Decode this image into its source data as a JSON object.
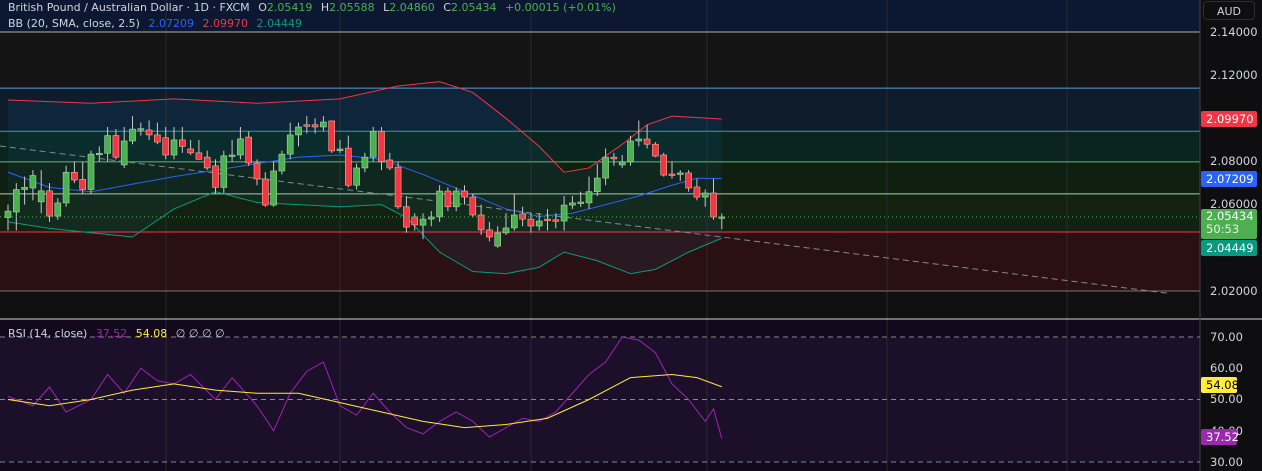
{
  "header": {
    "symbol": "British Pound / Australian Dollar · 1D · FXCM",
    "open_label": "O",
    "open": "2.05419",
    "high_label": "H",
    "high": "2.05588",
    "low_label": "L",
    "low": "2.04860",
    "close_label": "C",
    "close": "2.05434",
    "change": "+0.00015 (+0.01%)"
  },
  "bb_legend": {
    "label": "BB (20, SMA, close, 2.5)",
    "basis": "2.07209",
    "upper": "2.09970",
    "lower": "2.04449"
  },
  "rsi_legend": {
    "label": "RSI (14, close)",
    "rsi": "37.52",
    "ma": "54.08",
    "extras": "∅ ∅ ∅ ∅"
  },
  "price_axis": {
    "currency": "AUD",
    "ticks": [
      "2.14000",
      "2.12000",
      "2.08000",
      "2.06000",
      "2.02000"
    ],
    "upper_tag": "2.09970",
    "basis_tag": "2.07209",
    "last_price": "2.05434",
    "countdown": "50:53",
    "lower_tag": "2.04449"
  },
  "rsi_axis": {
    "ticks": [
      "70.00",
      "60.00",
      "50.00",
      "40.00",
      "30.00"
    ],
    "ma_tag": "54.08",
    "rsi_tag": "37.52"
  },
  "colors": {
    "up": "#4caf50",
    "down": "#f23645",
    "basis": "#2962ff",
    "upper": "#f23645",
    "lower": "#089981",
    "rsi": "#9c27b0",
    "rsi_ma": "#ffeb3b"
  },
  "chart_data": [
    {
      "type": "candlestick",
      "title": "British Pound / Australian Dollar · 1D · FXCM",
      "ylim": [
        2.0,
        2.15
      ],
      "grid": true,
      "candles": [
        [
          2.054,
          2.06,
          2.048,
          2.057
        ],
        [
          2.0566,
          2.07,
          2.048,
          2.067
        ],
        [
          2.067,
          2.073,
          2.06,
          2.068
        ],
        [
          2.0677,
          2.076,
          2.062,
          2.0735
        ],
        [
          2.0613,
          2.076,
          2.056,
          2.0664
        ],
        [
          2.0664,
          2.07,
          2.052,
          2.0547
        ],
        [
          2.0547,
          2.063,
          2.053,
          2.0608
        ],
        [
          2.0608,
          2.078,
          2.059,
          2.075
        ],
        [
          2.075,
          2.08,
          2.07,
          2.0714
        ],
        [
          2.0717,
          2.08,
          2.065,
          2.067
        ],
        [
          2.067,
          2.085,
          2.065,
          2.0834
        ],
        [
          2.0834,
          2.087,
          2.08,
          2.0838
        ],
        [
          2.0838,
          2.096,
          2.08,
          2.092
        ],
        [
          2.092,
          2.095,
          2.081,
          2.082
        ],
        [
          2.0784,
          2.096,
          2.077,
          2.0895
        ],
        [
          2.0895,
          2.101,
          2.088,
          2.095
        ],
        [
          2.095,
          2.098,
          2.092,
          2.0952
        ],
        [
          2.0946,
          2.099,
          2.09,
          2.0923
        ],
        [
          2.0923,
          2.098,
          2.088,
          2.089
        ],
        [
          2.091,
          2.096,
          2.081,
          2.083
        ],
        [
          2.083,
          2.096,
          2.081,
          2.09
        ],
        [
          2.09,
          2.096,
          2.084,
          2.087
        ],
        [
          2.0858,
          2.09,
          2.083,
          2.084
        ],
        [
          2.084,
          2.09,
          2.081,
          2.081
        ],
        [
          2.082,
          2.085,
          2.076,
          2.077
        ],
        [
          2.078,
          2.081,
          2.065,
          2.068
        ],
        [
          2.068,
          2.085,
          2.065,
          2.0826
        ],
        [
          2.0826,
          2.09,
          2.08,
          2.083
        ],
        [
          2.083,
          2.096,
          2.081,
          2.0905
        ],
        [
          2.0913,
          2.094,
          2.078,
          2.0793
        ],
        [
          2.0793,
          2.081,
          2.069,
          2.0719
        ],
        [
          2.0719,
          2.075,
          2.059,
          2.0598
        ],
        [
          2.0598,
          2.08,
          2.059,
          2.0756
        ],
        [
          2.0756,
          2.085,
          2.074,
          2.0834
        ],
        [
          2.0834,
          2.098,
          2.081,
          2.0923
        ],
        [
          2.0923,
          2.098,
          2.087,
          2.096
        ],
        [
          2.097,
          2.101,
          2.093,
          2.0968
        ],
        [
          2.097,
          2.1,
          2.093,
          2.096
        ],
        [
          2.096,
          2.101,
          2.094,
          2.0983
        ],
        [
          2.0988,
          2.099,
          2.084,
          2.0849
        ],
        [
          2.085,
          2.09,
          2.084,
          2.0858
        ],
        [
          2.0862,
          2.092,
          2.068,
          2.069
        ],
        [
          2.069,
          2.079,
          2.067,
          2.077
        ],
        [
          2.077,
          2.084,
          2.075,
          2.082
        ],
        [
          2.082,
          2.096,
          2.08,
          2.094
        ],
        [
          2.094,
          2.096,
          2.076,
          2.08
        ],
        [
          2.0807,
          2.084,
          2.076,
          2.077
        ],
        [
          2.0774,
          2.08,
          2.058,
          2.059
        ],
        [
          2.059,
          2.064,
          2.047,
          2.0496
        ],
        [
          2.0543,
          2.056,
          2.048,
          2.0506
        ],
        [
          2.0505,
          2.056,
          2.044,
          2.0533
        ],
        [
          2.0533,
          2.057,
          2.05,
          2.0543
        ],
        [
          2.0543,
          2.069,
          2.052,
          2.0663
        ],
        [
          2.0663,
          2.068,
          2.057,
          2.059
        ],
        [
          2.059,
          2.068,
          2.057,
          2.0663
        ],
        [
          2.0663,
          2.069,
          2.06,
          2.0635
        ],
        [
          2.0635,
          2.065,
          2.054,
          2.0552
        ],
        [
          2.0552,
          2.06,
          2.046,
          2.0483
        ],
        [
          2.0483,
          2.052,
          2.043,
          2.045
        ],
        [
          2.0408,
          2.05,
          2.04,
          2.0469
        ],
        [
          2.0469,
          2.056,
          2.046,
          2.0492
        ],
        [
          2.0492,
          2.065,
          2.048,
          2.0552
        ],
        [
          2.0557,
          2.059,
          2.05,
          2.0533
        ],
        [
          2.0533,
          2.056,
          2.047,
          2.0501
        ],
        [
          2.0501,
          2.056,
          2.048,
          2.0524
        ],
        [
          2.0533,
          2.058,
          2.048,
          2.0531
        ],
        [
          2.053,
          2.056,
          2.049,
          2.0528
        ],
        [
          2.0524,
          2.064,
          2.048,
          2.0598
        ],
        [
          2.0598,
          2.064,
          2.058,
          2.0608
        ],
        [
          2.0608,
          2.066,
          2.059,
          2.0612
        ],
        [
          2.0608,
          2.073,
          2.058,
          2.066
        ],
        [
          2.066,
          2.079,
          2.064,
          2.0723
        ],
        [
          2.0723,
          2.086,
          2.069,
          2.082
        ],
        [
          2.082,
          2.084,
          2.078,
          2.0812
        ],
        [
          2.0784,
          2.083,
          2.077,
          2.0798
        ],
        [
          2.0798,
          2.092,
          2.078,
          2.0895
        ],
        [
          2.0895,
          2.099,
          2.087,
          2.0904
        ],
        [
          2.0904,
          2.097,
          2.086,
          2.088
        ],
        [
          2.088,
          2.089,
          2.082,
          2.0825
        ],
        [
          2.083,
          2.084,
          2.073,
          2.0737
        ],
        [
          2.0742,
          2.08,
          2.072,
          2.074
        ],
        [
          2.074,
          2.076,
          2.071,
          2.0747
        ],
        [
          2.0747,
          2.076,
          2.066,
          2.0677
        ],
        [
          2.0682,
          2.072,
          2.062,
          2.0635
        ],
        [
          2.0635,
          2.067,
          2.059,
          2.0654
        ],
        [
          2.0654,
          2.072,
          2.053,
          2.0543
        ],
        [
          2.05419,
          2.05588,
          2.0486,
          2.05434
        ]
      ],
      "bollinger": {
        "upper": [
          [
            0,
            2.1085
          ],
          [
            10,
            2.107
          ],
          [
            20,
            2.109
          ],
          [
            30,
            2.107
          ],
          [
            40,
            2.109
          ],
          [
            47,
            2.115
          ],
          [
            52,
            2.117
          ],
          [
            56,
            2.112
          ],
          [
            60,
            2.1
          ],
          [
            64,
            2.087
          ],
          [
            67,
            2.075
          ],
          [
            70,
            2.077
          ],
          [
            74,
            2.088
          ],
          [
            77,
            2.097
          ],
          [
            80,
            2.101
          ],
          [
            86,
            2.0997
          ]
        ],
        "basis": [
          [
            0,
            2.075
          ],
          [
            5,
            2.068
          ],
          [
            10,
            2.066
          ],
          [
            20,
            2.073
          ],
          [
            25,
            2.076
          ],
          [
            30,
            2.079
          ],
          [
            35,
            2.082
          ],
          [
            40,
            2.083
          ],
          [
            45,
            2.081
          ],
          [
            50,
            2.074
          ],
          [
            55,
            2.066
          ],
          [
            60,
            2.058
          ],
          [
            64,
            2.0545
          ],
          [
            68,
            2.056
          ],
          [
            72,
            2.06
          ],
          [
            76,
            2.064
          ],
          [
            80,
            2.069
          ],
          [
            83,
            2.0722
          ],
          [
            86,
            2.07209
          ]
        ],
        "lower": [
          [
            0,
            2.052
          ],
          [
            5,
            2.049
          ],
          [
            10,
            2.047
          ],
          [
            15,
            2.045
          ],
          [
            20,
            2.058
          ],
          [
            25,
            2.066
          ],
          [
            30,
            2.061
          ],
          [
            35,
            2.06
          ],
          [
            40,
            2.059
          ],
          [
            45,
            2.06
          ],
          [
            48,
            2.054
          ],
          [
            52,
            2.038
          ],
          [
            56,
            2.029
          ],
          [
            60,
            2.028
          ],
          [
            64,
            2.031
          ],
          [
            67,
            2.038
          ],
          [
            71,
            2.034
          ],
          [
            75,
            2.028
          ],
          [
            78,
            2.03
          ],
          [
            82,
            2.038
          ],
          [
            86,
            2.04449
          ]
        ]
      },
      "levels": [
        2.114,
        2.094,
        2.0798,
        2.065,
        2.0473
      ],
      "level_colors": [
        "#5b9bd5",
        "#26a69a",
        "#66bb6a",
        "#a5d6a7",
        "#f23645"
      ],
      "trendline": [
        [
          0,
          2.0872
        ],
        [
          140,
          2.0188
        ]
      ]
    },
    {
      "type": "line",
      "title": "RSI (14, close)",
      "ylim": [
        25,
        75
      ],
      "bands": [
        30,
        50,
        70
      ],
      "series": [
        {
          "name": "RSI",
          "values": [
            [
              0,
              51
            ],
            [
              3,
              48
            ],
            [
              5,
              54
            ],
            [
              7,
              46
            ],
            [
              10,
              50
            ],
            [
              12,
              58
            ],
            [
              14,
              52
            ],
            [
              16,
              60
            ],
            [
              18,
              56
            ],
            [
              20,
              55
            ],
            [
              22,
              58
            ],
            [
              25,
              50
            ],
            [
              27,
              57
            ],
            [
              30,
              48
            ],
            [
              32,
              40
            ],
            [
              34,
              52
            ],
            [
              36,
              59
            ],
            [
              38,
              62
            ],
            [
              40,
              48
            ],
            [
              42,
              45
            ],
            [
              44,
              52
            ],
            [
              46,
              46
            ],
            [
              48,
              41
            ],
            [
              50,
              39
            ],
            [
              52,
              43
            ],
            [
              54,
              46
            ],
            [
              56,
              43
            ],
            [
              58,
              38
            ],
            [
              60,
              41
            ],
            [
              62,
              44
            ],
            [
              64,
              43
            ],
            [
              66,
              46
            ],
            [
              68,
              52
            ],
            [
              70,
              58
            ],
            [
              72,
              62
            ],
            [
              74,
              70
            ],
            [
              76,
              69
            ],
            [
              78,
              65
            ],
            [
              80,
              55
            ],
            [
              82,
              50
            ],
            [
              84,
              43
            ],
            [
              85,
              47
            ],
            [
              86,
              37.52
            ]
          ]
        },
        {
          "name": "MA",
          "values": [
            [
              0,
              50
            ],
            [
              5,
              48
            ],
            [
              10,
              50
            ],
            [
              15,
              53
            ],
            [
              20,
              55
            ],
            [
              25,
              53
            ],
            [
              30,
              52
            ],
            [
              35,
              52
            ],
            [
              40,
              49
            ],
            [
              45,
              46
            ],
            [
              50,
              43
            ],
            [
              55,
              41
            ],
            [
              60,
              42
            ],
            [
              65,
              44
            ],
            [
              70,
              50
            ],
            [
              75,
              57
            ],
            [
              80,
              58
            ],
            [
              83,
              57
            ],
            [
              86,
              54.08
            ]
          ]
        }
      ]
    }
  ]
}
